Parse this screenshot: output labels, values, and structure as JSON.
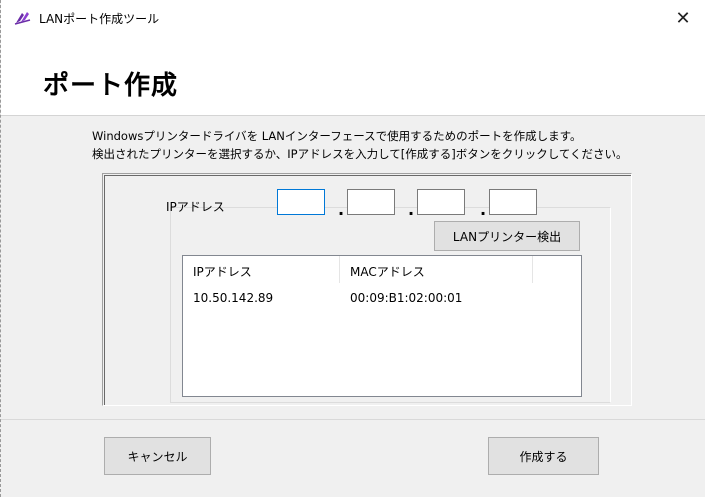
{
  "window": {
    "title": "LANポート作成ツール",
    "close_glyph": "✕"
  },
  "header": {
    "title": "ポート作成"
  },
  "description": {
    "line1": "Windowsプリンタードライバを LANインターフェースで使用するためのポートを作成します。",
    "line2": "検出されたプリンターを選択するか、IPアドレスを入力して[作成する]ボタンをクリックしてください。"
  },
  "ip_input": {
    "label": "IPアドレス",
    "octets": [
      "",
      "",
      "",
      ""
    ],
    "separator": "."
  },
  "detect_button": {
    "label": "LANプリンター検出"
  },
  "printer_list": {
    "columns": [
      "IPアドレス",
      "MACアドレス"
    ],
    "rows": [
      [
        "10.50.142.89",
        "00:09:B1:02:00:01"
      ]
    ]
  },
  "footer": {
    "cancel_label": "キャンセル",
    "create_label": "作成する"
  },
  "colors": {
    "accent": "#0078d7",
    "window_bg": "#f0f0f0",
    "button_bg": "#e1e1e1"
  },
  "icons": {
    "app": "printer-tool-icon",
    "close": "close-icon"
  }
}
